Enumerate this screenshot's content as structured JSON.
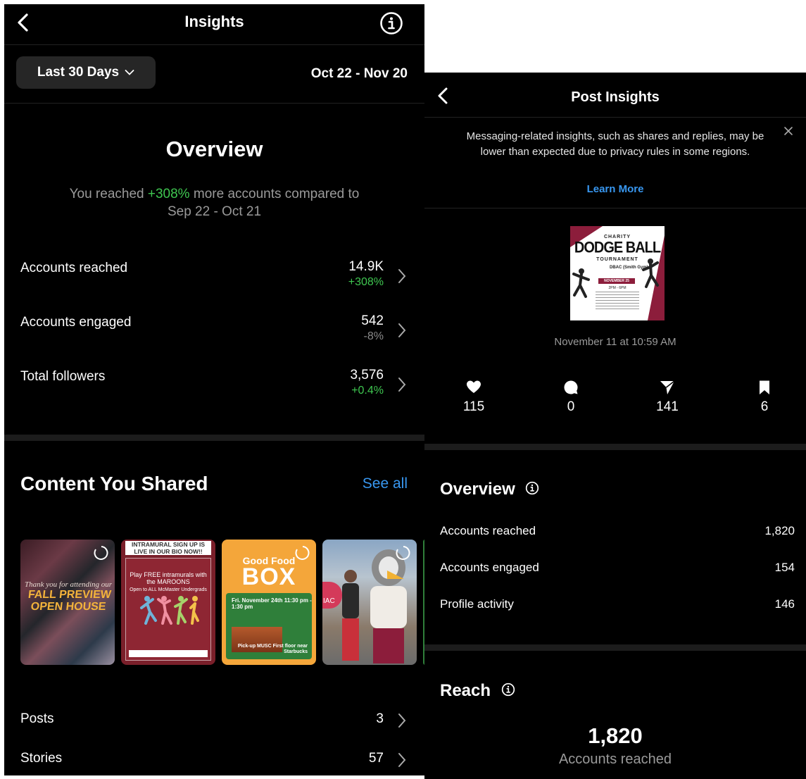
{
  "insights": {
    "title": "Insights",
    "range_button": "Last 30 Days",
    "date_range": "Oct 22 - Nov 20",
    "overview": {
      "title": "Overview",
      "sub_prefix": "You reached ",
      "sub_pct": "+308%",
      "sub_suffix": " more accounts compared to",
      "sub_compare": "Sep 22 - Oct 21"
    },
    "metrics": [
      {
        "label": "Accounts reached",
        "value": "14.9K",
        "change": "+308%",
        "change_color": "#3fc650"
      },
      {
        "label": "Accounts engaged",
        "value": "542",
        "change": "-8%",
        "change_color": "#8a8a8a"
      },
      {
        "label": "Total followers",
        "value": "3,576",
        "change": "+0.4%",
        "change_color": "#3fc650"
      }
    ],
    "content": {
      "title": "Content You Shared",
      "see_all": "See all",
      "thumbs": [
        {
          "line1": "Thank you for attending our",
          "line2": "FALL PREVIEW OPEN HOUSE"
        },
        {
          "top": "INTRAMURAL SIGN UP IS LIVE IN OUR BIO NOW!!",
          "headline": "Play FREE intramurals with the MAROONS",
          "sub": "Open to ALL McMaster Undergrads"
        },
        {
          "line1": "Good Food",
          "line2": "BOX",
          "date": "Fri. November 24th 11:30 pm - 1:30 pm",
          "pickup": "Pick-up MUSC First floor near Starbucks"
        },
        {
          "badge": "IAC"
        }
      ],
      "rows": [
        {
          "label": "Posts",
          "value": "3"
        },
        {
          "label": "Stories",
          "value": "57"
        }
      ]
    }
  },
  "post_insights": {
    "title": "Post Insights",
    "notice": "Messaging-related insights, such as shares and replies, may be lower than expected due to privacy rules in some regions.",
    "learn_more": "Learn More",
    "post_image": {
      "charity": "CHARITY",
      "dodge": "DODGE BALL",
      "tournament": "TOURNAMENT",
      "location": "DBAC (Smith Gym)",
      "date": "NOVEMBER 25",
      "time": "2PM - 6PM"
    },
    "post_date": "November 11 at 10:59 AM",
    "stats": [
      {
        "icon": "heart-icon",
        "value": "115"
      },
      {
        "icon": "comment-icon",
        "value": "0"
      },
      {
        "icon": "share-icon",
        "value": "141"
      },
      {
        "icon": "bookmark-icon",
        "value": "6"
      }
    ],
    "overview": {
      "title": "Overview",
      "rows": [
        {
          "label": "Accounts reached",
          "value": "1,820"
        },
        {
          "label": "Accounts engaged",
          "value": "154"
        },
        {
          "label": "Profile activity",
          "value": "146"
        }
      ]
    },
    "reach": {
      "title": "Reach",
      "value": "1,820",
      "label": "Accounts reached"
    }
  }
}
